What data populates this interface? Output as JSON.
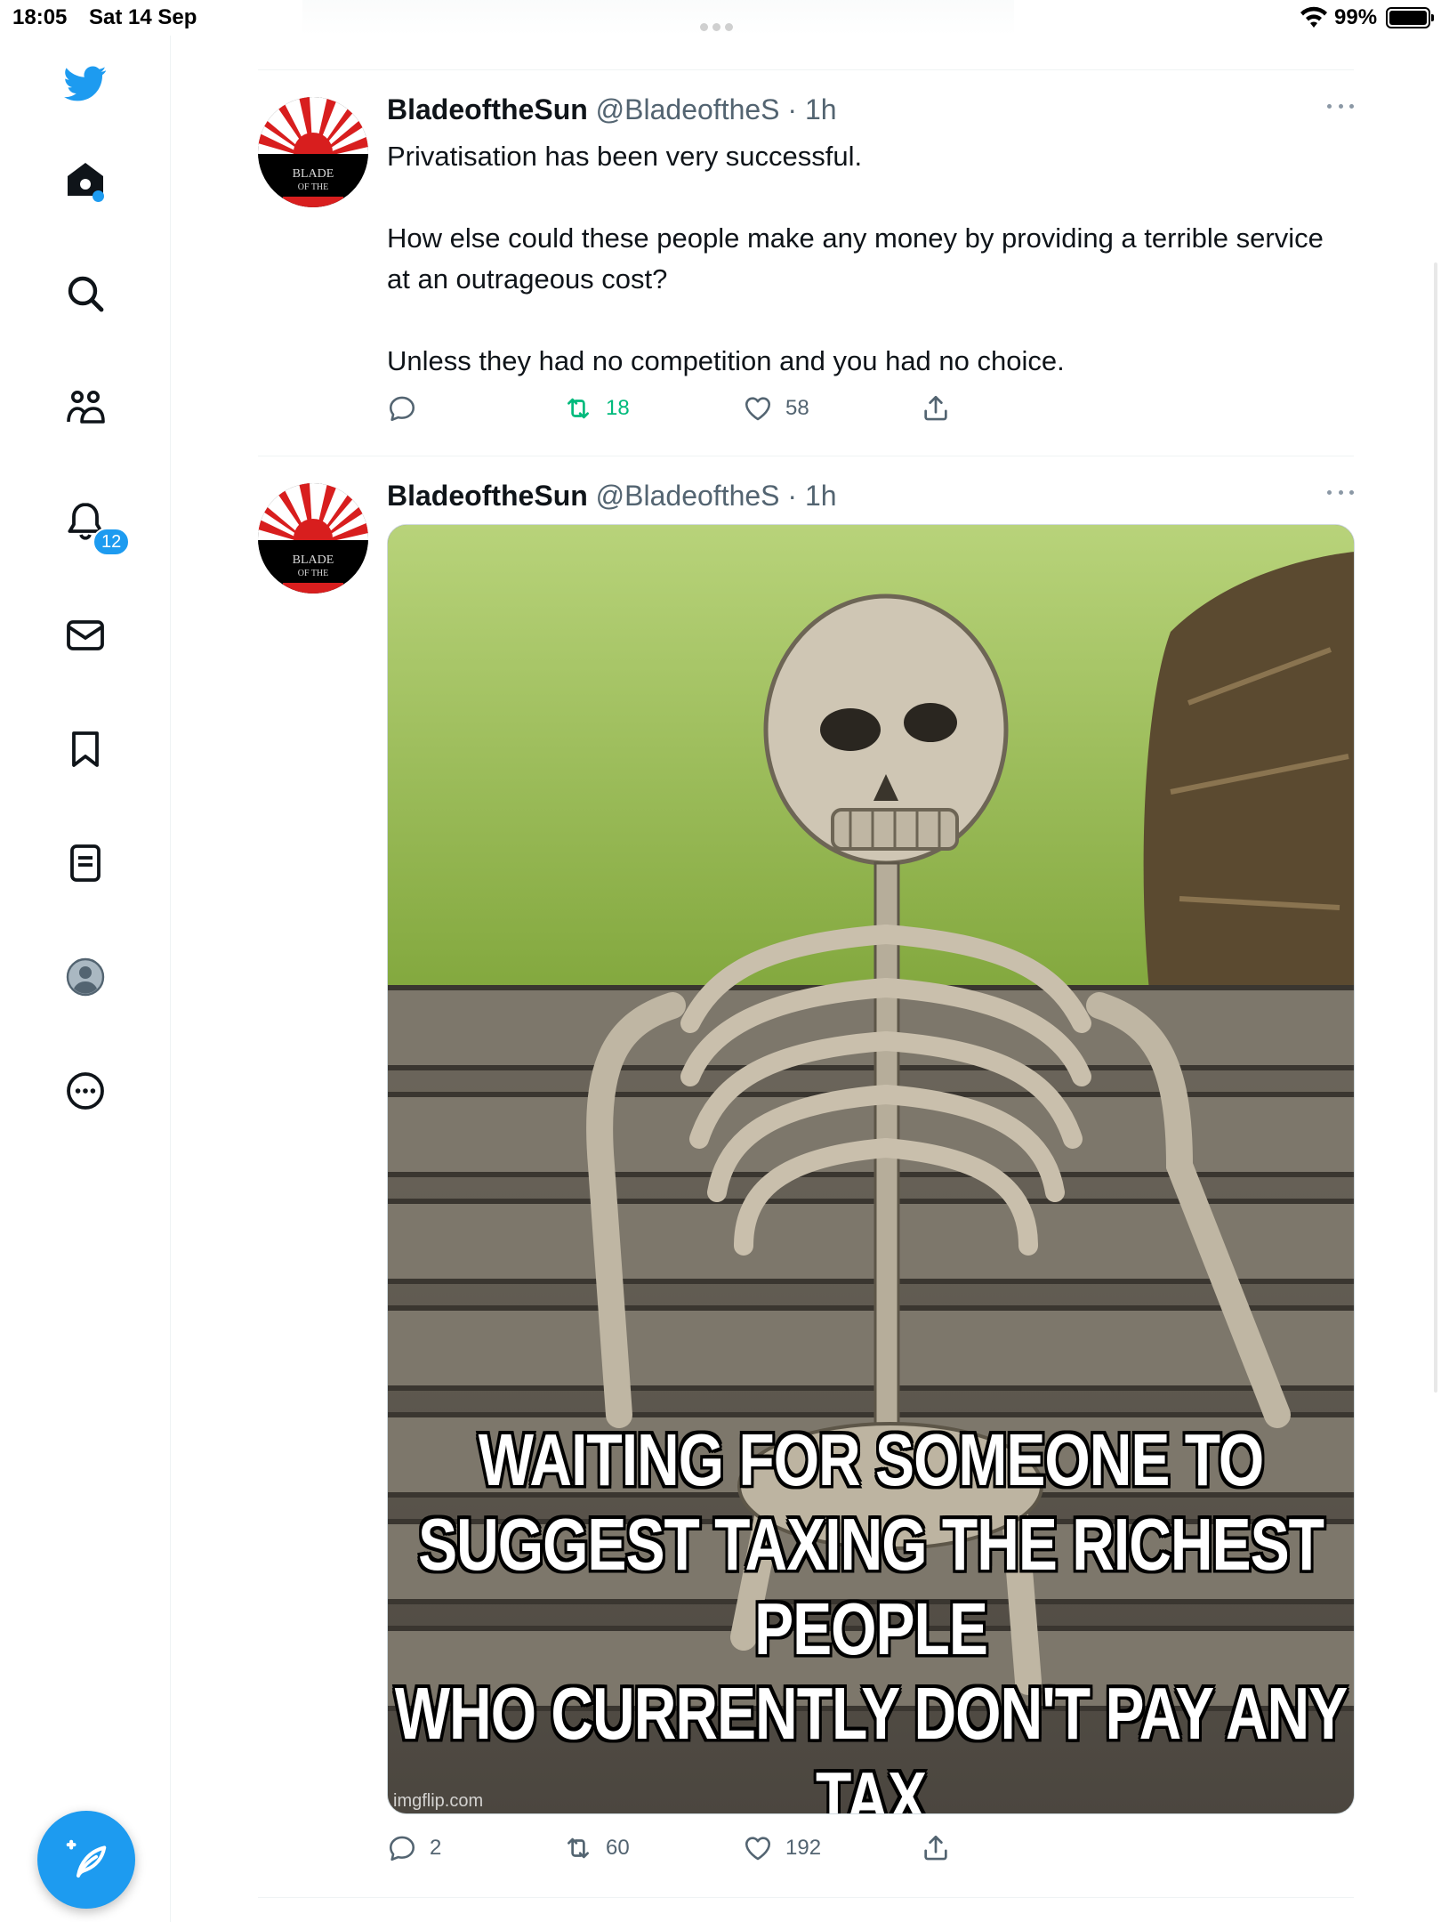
{
  "status_bar": {
    "time": "18:05",
    "date": "Sat 14 Sep",
    "battery_percent": "99%"
  },
  "sidebar": {
    "items": [
      {
        "name": "home",
        "icon": "home-icon",
        "has_dot": true
      },
      {
        "name": "explore",
        "icon": "search-icon"
      },
      {
        "name": "communities",
        "icon": "communities-icon"
      },
      {
        "name": "notifications",
        "icon": "bell-icon",
        "badge": "12"
      },
      {
        "name": "messages",
        "icon": "mail-icon"
      },
      {
        "name": "bookmarks",
        "icon": "bookmark-icon"
      },
      {
        "name": "lists",
        "icon": "list-icon"
      },
      {
        "name": "profile",
        "icon": "profile-icon"
      },
      {
        "name": "more",
        "icon": "more-circle-icon"
      }
    ],
    "notifications_badge": "12"
  },
  "tweets": [
    {
      "display_name": "BladeoftheSun",
      "handle": "@BladeoftheS",
      "time": "1h",
      "separator": " · ",
      "text_lines": [
        "Privatisation has been very successful.",
        "How else could these people make any money by providing a terrible service at an outrageous cost?",
        "Unless they had no competition and you had no choice."
      ],
      "replies": "",
      "retweets": "18",
      "likes": "58"
    },
    {
      "display_name": "BladeoftheSun",
      "handle": "@BladeoftheS",
      "time": "1h",
      "separator": " · ",
      "media": {
        "caption_lines": [
          "WAITING FOR SOMEONE TO",
          "SUGGEST TAXING THE RICHEST PEOPLE",
          "WHO CURRENTLY DON'T PAY ANY TAX"
        ],
        "watermark": "imgflip.com"
      },
      "replies": "2",
      "retweets": "60",
      "likes": "192"
    }
  ],
  "colors": {
    "accent": "#1d9bf0",
    "retweet_active": "#00ba7c",
    "muted": "#536471"
  }
}
